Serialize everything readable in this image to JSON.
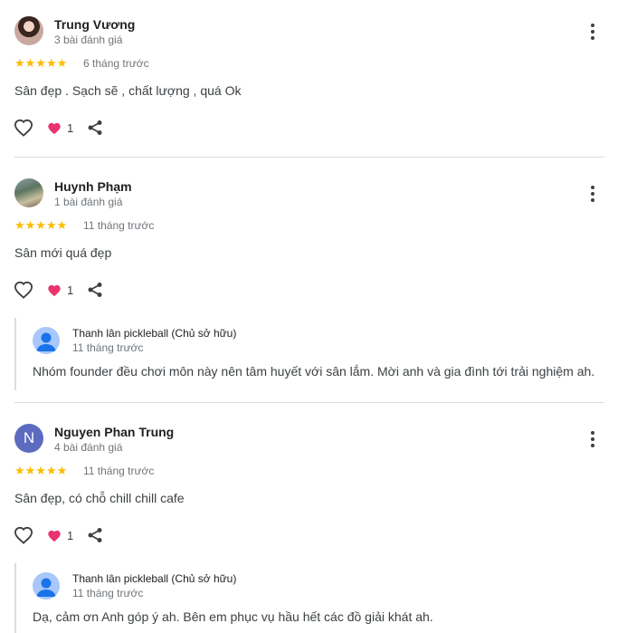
{
  "reviews": [
    {
      "name": "Trung Vương",
      "meta": "3 bài đánh giá",
      "stars": "★★★★★",
      "time": "6 tháng trước",
      "text": "Sân đẹp . Sạch sẽ , chất lượng , quá Ok",
      "likes": "1"
    },
    {
      "name": "Huynh Phạm",
      "meta": "1 bài đánh giá",
      "stars": "★★★★★",
      "time": "11 tháng trước",
      "text": "Sân mới quá đẹp",
      "likes": "1",
      "reply": {
        "owner": "Thanh lân pickleball (Chủ sở hữu)",
        "time": "11 tháng trước",
        "text": "Nhóm founder đều chơi môn này nên tâm huyết với sân lắm. Mời anh và gia đình tới trải nghiệm ah."
      }
    },
    {
      "name": "Nguyen Phan Trung",
      "initial": "N",
      "meta": "4 bài đánh giá",
      "stars": "★★★★★",
      "time": "11 tháng trước",
      "text": "Sân đẹp, có chỗ chill chill cafe",
      "likes": "1",
      "reply": {
        "owner": "Thanh lân pickleball (Chủ sở hữu)",
        "time": "11 tháng trước",
        "text": "Dạ, cảm ơn Anh góp ý ah. Bên em phục vụ hầu hết các đồ giải khát ah."
      }
    }
  ],
  "colors": {
    "star": "#fbbc04",
    "heart_badge": "#e8336d",
    "letter_avatar": "#5c6bc0",
    "owner_avatar": "#a8c7fa",
    "divider": "#dadce0"
  },
  "icons": [
    "more-vert-icon",
    "heart-outline-icon",
    "heart-filled-icon",
    "share-icon",
    "person-icon"
  ]
}
